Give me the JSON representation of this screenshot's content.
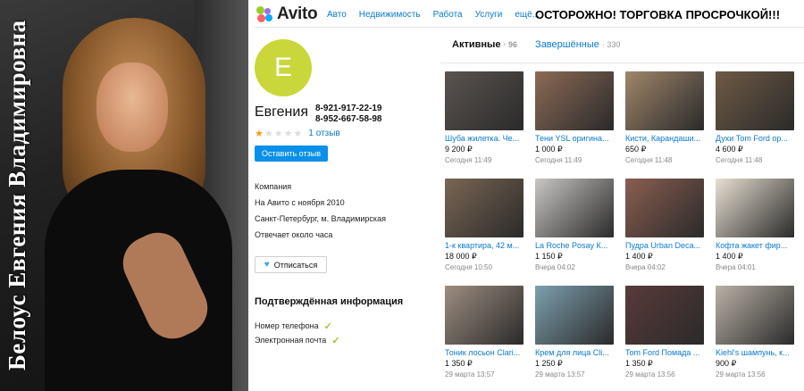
{
  "photo": {
    "caption": "Белоус Евгения Владимировна"
  },
  "header": {
    "logo": "Avito",
    "nav": [
      "Авто",
      "Недвижимость",
      "Работа",
      "Услуги",
      "ещё..."
    ],
    "warning": "ОСТОРОЖНО! ТОРГОВКА ПРОСРОЧКОЙ!!!"
  },
  "profile": {
    "avatar_letter": "Е",
    "name": "Евгения",
    "phone1": "8-921-917-22-19",
    "phone2": "8-952-667-58-98",
    "rating": 1,
    "rating_max": 5,
    "reviews": "1 отзыв",
    "review_button": "Оставить отзыв",
    "info": [
      "Компания",
      "На Авито с ноября 2010",
      "Санкт-Петербург, м. Владимирская",
      "Отвечает около часа"
    ],
    "subscribe_button": "Отписаться",
    "verified_title": "Подтверждённая информация",
    "verified": [
      "Номер телефона",
      "Электронная почта"
    ]
  },
  "tabs": [
    {
      "label": "Активные",
      "count": "96"
    },
    {
      "label": "Завершённые",
      "count": "330"
    }
  ],
  "listings": [
    {
      "title": "Шуба жилетка. Че...",
      "price": "9 200 ₽",
      "date": "Сегодня 11:49",
      "color": "#5b5450"
    },
    {
      "title": "Тени YSL оригина...",
      "price": "1 000 ₽",
      "date": "Сегодня 11:49",
      "color": "#8c6a56"
    },
    {
      "title": "Кисти, Карандаши...",
      "price": "650 ₽",
      "date": "Сегодня 11:48",
      "color": "#a0866a"
    },
    {
      "title": "Духи Tom Ford ор...",
      "price": "4 600 ₽",
      "date": "Сегодня 11:48",
      "color": "#6f5a44"
    },
    {
      "title": "1-к квартира, 42 м...",
      "price": "18 000 ₽",
      "date": "Сегодня 10:50",
      "color": "#7a6654"
    },
    {
      "title": "La Roche Posay К...",
      "price": "1 150 ₽",
      "date": "Вчера 04:02",
      "color": "#c9c6c4"
    },
    {
      "title": "Пудра Urban Deca...",
      "price": "1 400 ₽",
      "date": "Вчера 04:02",
      "color": "#8a5e50"
    },
    {
      "title": "Кофта жакет фир...",
      "price": "1 400 ₽",
      "date": "Вчера 04:01",
      "color": "#e8e0d2"
    },
    {
      "title": "Тоник лосьон Clari...",
      "price": "1 350 ₽",
      "date": "29 марта 13:57",
      "color": "#9d8d80"
    },
    {
      "title": "Крем для лица Cli...",
      "price": "1 250 ₽",
      "date": "29 марта 13:57",
      "color": "#7d9fae"
    },
    {
      "title": "Tom Ford Помада ...",
      "price": "1 350 ₽",
      "date": "29 марта 13:56",
      "color": "#5a3a3a"
    },
    {
      "title": "Kiehl's шампунь, к...",
      "price": "900 ₽",
      "date": "29 марта 13:56",
      "color": "#b9b1a6"
    }
  ]
}
